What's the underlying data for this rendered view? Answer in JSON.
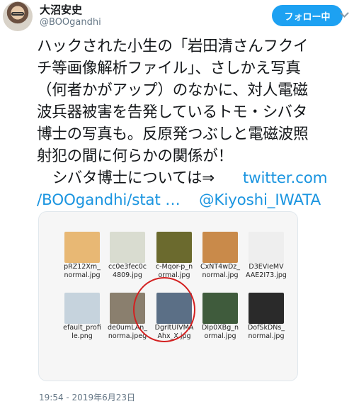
{
  "user": {
    "name": "大沼安史",
    "handle": "@BOOgandhi"
  },
  "follow_button": {
    "label": "フォロー中"
  },
  "tweet_lines": [
    "ハックされた小生の「岩田清さんフクイ",
    "チ等画像解析ファイル」、さしかえ写真",
    "（何者かがアップ）のなかに、対人電磁",
    "波兵器被害を告発しているトモ・シバタ",
    "博士の写真も。反原発つぶしと電磁波照",
    "射犯の間に何らかの関係が！"
  ],
  "tweet_line7": {
    "text": "シバタ博士については⇒",
    "link": "twitter.com"
  },
  "tweet_line8": {
    "link1": "/BOOgandhi/stat …",
    "mention": "@Kiyoshi_IWATA"
  },
  "thumbnails": [
    {
      "cap1": "pRZ12Xm_",
      "cap2": "normal.jpg",
      "color": "#e8b874"
    },
    {
      "cap1": "cc0e3fec0c",
      "cap2": "4809.jpg",
      "color": "#d9dcd0"
    },
    {
      "cap1": "c-Mqor-p_n",
      "cap2": "ormal.jpg",
      "color": "#6b6a2e"
    },
    {
      "cap1": "CxNT4wDz_",
      "cap2": "normal.jpg",
      "color": "#c98a4a"
    },
    {
      "cap1": "D3EVIeMV",
      "cap2": "AAE2I73.jpg",
      "color": "#eeeeee"
    },
    {
      "cap1": "efault_profi",
      "cap2": "le.png",
      "color": "#c6d3dd"
    },
    {
      "cap1": "de0umLAn_",
      "cap2": "norma.jpeg",
      "color": "#8a7f6e"
    },
    {
      "cap1": "DgrItUIVMA",
      "cap2": "Ahx_X.jpg",
      "color": "#5b6f86"
    },
    {
      "cap1": "DIp0XBg_n",
      "cap2": "ormal.jpg",
      "color": "#3f5b3c"
    },
    {
      "cap1": "DofSkDNs_",
      "cap2": "normal.jpg",
      "color": "#2a2a2a"
    }
  ],
  "timestamp": "19:54 - 2019年6月23日",
  "colors": {
    "accent": "#1da1f2",
    "link": "#1b95e0",
    "highlight": "#d32020"
  }
}
